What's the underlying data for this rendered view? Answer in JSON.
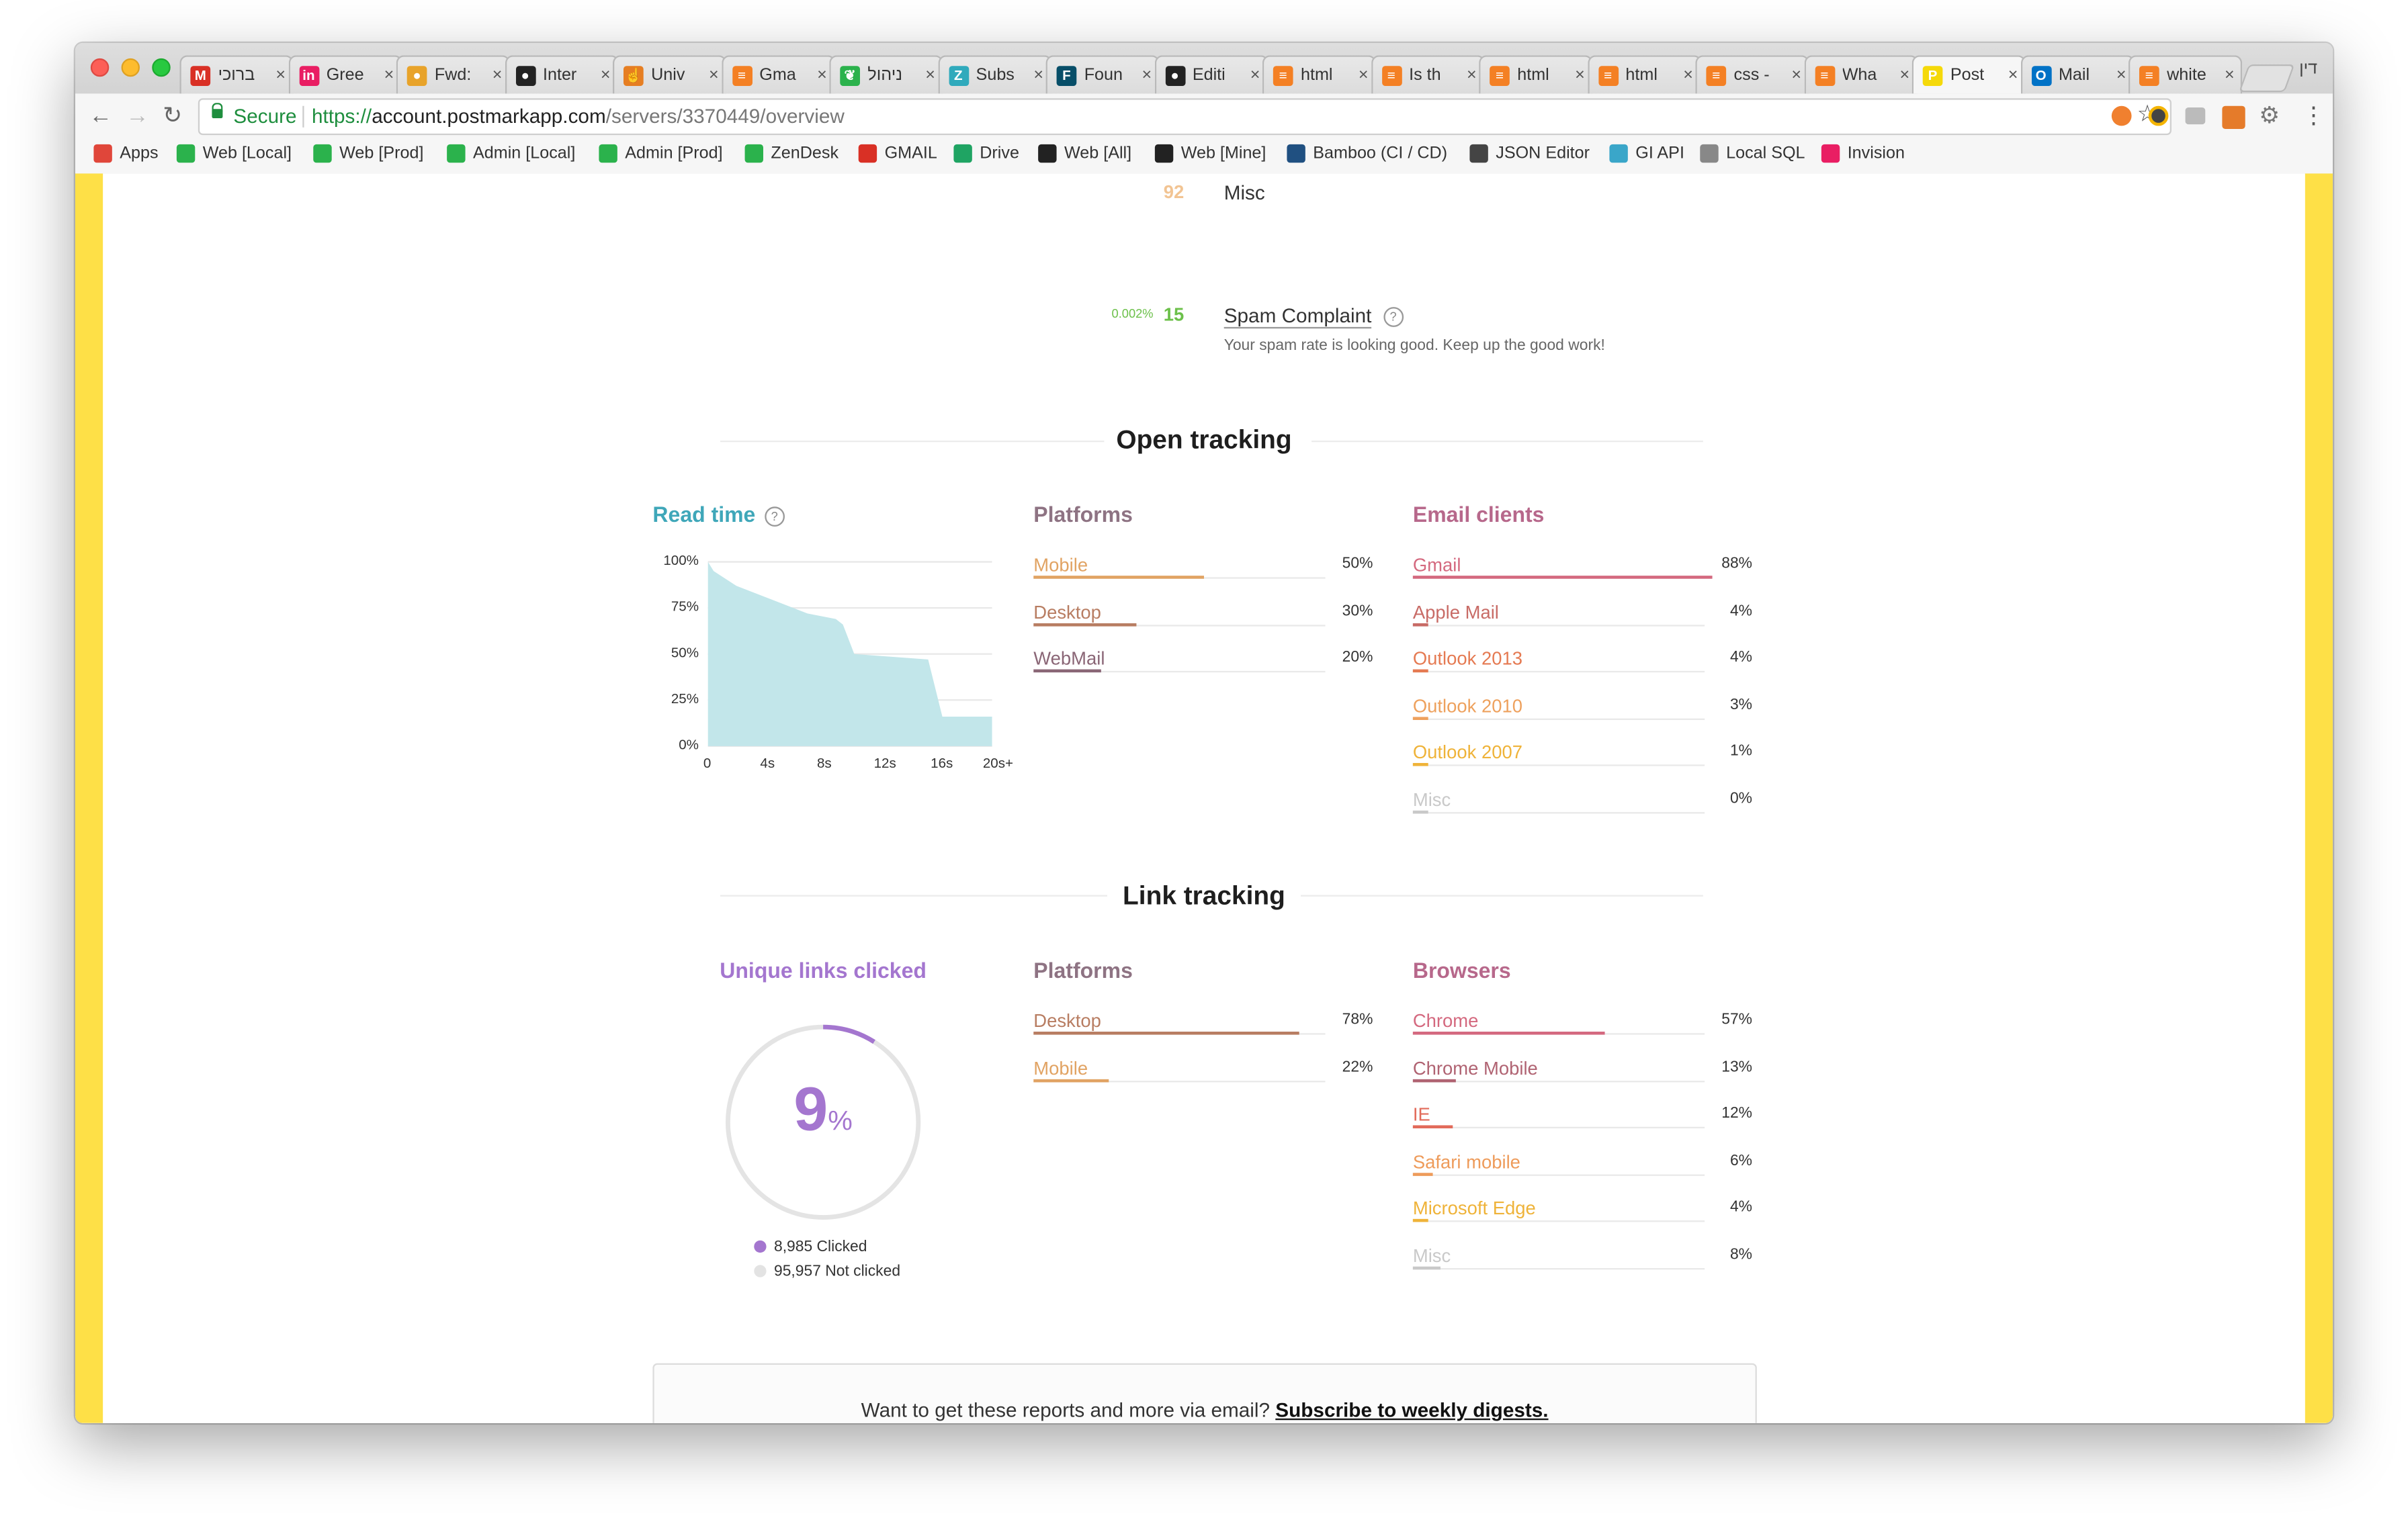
{
  "browser": {
    "tabs": [
      {
        "label": "ברוכי",
        "icon": "gmail-icon",
        "color": "#d93025",
        "glyph": "M"
      },
      {
        "label": "Gree",
        "icon": "invision-icon",
        "color": "#e91e63",
        "glyph": "in"
      },
      {
        "label": "Fwd:",
        "icon": "chrome-webstore-icon",
        "color": "#e8a32a",
        "glyph": "●"
      },
      {
        "label": "Inter",
        "icon": "github-icon",
        "color": "#222222",
        "glyph": "●"
      },
      {
        "label": "Univ",
        "icon": "hand-icon",
        "color": "#e67e22",
        "glyph": "☝"
      },
      {
        "label": "Gma",
        "icon": "stackoverflow-icon",
        "color": "#f48024",
        "glyph": "≡"
      },
      {
        "label": "ניהול",
        "icon": "leaf-icon",
        "color": "#2bb24c",
        "glyph": "❦"
      },
      {
        "label": "Subs",
        "icon": "zendesk-icon",
        "color": "#30aabc",
        "glyph": "Z"
      },
      {
        "label": "Foun",
        "icon": "foundation-icon",
        "color": "#074e68",
        "glyph": "F"
      },
      {
        "label": "Editi",
        "icon": "github-icon",
        "color": "#222222",
        "glyph": "●"
      },
      {
        "label": "html",
        "icon": "stackoverflow-icon",
        "color": "#f48024",
        "glyph": "≡"
      },
      {
        "label": "Is th",
        "icon": "stackoverflow-icon",
        "color": "#f48024",
        "glyph": "≡"
      },
      {
        "label": "html",
        "icon": "stackoverflow-icon",
        "color": "#f48024",
        "glyph": "≡"
      },
      {
        "label": "html",
        "icon": "stackoverflow-icon",
        "color": "#f48024",
        "glyph": "≡"
      },
      {
        "label": "css -",
        "icon": "stackoverflow-icon",
        "color": "#f48024",
        "glyph": "≡"
      },
      {
        "label": "Wha",
        "icon": "stackoverflow-icon",
        "color": "#f48024",
        "glyph": "≡"
      },
      {
        "label": "Post",
        "icon": "postmark-icon",
        "color": "#f5d90a",
        "glyph": "P",
        "active": true
      },
      {
        "label": "Mail",
        "icon": "outlook-icon",
        "color": "#0072c6",
        "glyph": "O"
      },
      {
        "label": "white",
        "icon": "stackoverflow-icon",
        "color": "#f48024",
        "glyph": "≡"
      }
    ],
    "tab_close": "×",
    "profile_label": "דין",
    "url_secure": "Secure",
    "url_scheme": "https://",
    "url_host": "account.postmarkapp.com",
    "url_path": "/servers/3370449/overview",
    "bookmarks": [
      {
        "label": "Apps",
        "icon": "apps-grid-icon",
        "color": "#e0463a"
      },
      {
        "label": "Web [Local]",
        "icon": "leaf-icon",
        "color": "#2bb24c"
      },
      {
        "label": "Web [Prod]",
        "icon": "leaf-icon",
        "color": "#2bb24c"
      },
      {
        "label": "Admin [Local]",
        "icon": "leaf-icon",
        "color": "#2bb24c"
      },
      {
        "label": "Admin [Prod]",
        "icon": "leaf-icon",
        "color": "#2bb24c"
      },
      {
        "label": "ZenDesk",
        "icon": "zendesk-icon",
        "color": "#2bb24c"
      },
      {
        "label": "GMAIL",
        "icon": "gmail-icon",
        "color": "#d93025"
      },
      {
        "label": "Drive",
        "icon": "drive-icon",
        "color": "#1fa463"
      },
      {
        "label": "Web [All]",
        "icon": "github-icon",
        "color": "#222222"
      },
      {
        "label": "Web [Mine]",
        "icon": "github-icon",
        "color": "#222222"
      },
      {
        "label": "Bamboo (CI / CD)",
        "icon": "bamboo-icon",
        "color": "#205081"
      },
      {
        "label": "JSON Editor",
        "icon": "json-icon",
        "color": "#444444"
      },
      {
        "label": "GI API",
        "icon": "api-icon",
        "color": "#3aa6c9"
      },
      {
        "label": "Local SQL",
        "icon": "sql-icon",
        "color": "#888888"
      },
      {
        "label": "Invision",
        "icon": "invision-icon",
        "color": "#e91e63"
      }
    ]
  },
  "page": {
    "misc_count": "92",
    "misc_label": "Misc",
    "spam_rate": "0.002%",
    "spam_count": "15",
    "spam_label": "Spam Complaint",
    "spam_note": "Your spam rate is looking good. Keep up the good work!",
    "help_glyph": "?",
    "open_tracking": {
      "title": "Open tracking",
      "read_time_label": "Read time",
      "read_time_chart": {
        "y_ticks": [
          "100%",
          "75%",
          "50%",
          "25%",
          "0%"
        ],
        "x_ticks": [
          "0",
          "4s",
          "8s",
          "12s",
          "16s",
          "20s+"
        ]
      },
      "platforms_title": "Platforms",
      "platforms": [
        {
          "label": "Mobile",
          "pct": "50%",
          "value": 0.5,
          "color": "#e1a363"
        },
        {
          "label": "Desktop",
          "pct": "30%",
          "value": 0.3,
          "color": "#b87d62"
        },
        {
          "label": "WebMail",
          "pct": "20%",
          "value": 0.2,
          "color": "#8a6676"
        }
      ],
      "clients_title": "Email clients",
      "clients": [
        {
          "label": "Gmail",
          "pct": "88%",
          "value": 0.88,
          "color": "#d4697f"
        },
        {
          "label": "Apple Mail",
          "pct": "4%",
          "value": 0.04,
          "color": "#c86b66"
        },
        {
          "label": "Outlook 2013",
          "pct": "4%",
          "value": 0.04,
          "color": "#e57a52"
        },
        {
          "label": "Outlook 2010",
          "pct": "3%",
          "value": 0.03,
          "color": "#eea15d"
        },
        {
          "label": "Outlook 2007",
          "pct": "1%",
          "value": 0.01,
          "color": "#efb339"
        },
        {
          "label": "Misc",
          "pct": "0%",
          "value": 0.0,
          "color": "#c9c9c9"
        }
      ]
    },
    "link_tracking": {
      "title": "Link tracking",
      "unique_title": "Unique links clicked",
      "unique_pct_value": 0.09,
      "unique_pct_number": "9",
      "unique_pct_symbol": "%",
      "clicked": "8,985 Clicked",
      "not_clicked": "95,957 Not clicked",
      "platforms_title": "Platforms",
      "platforms": [
        {
          "label": "Desktop",
          "pct": "78%",
          "value": 0.78,
          "color": "#b87d62"
        },
        {
          "label": "Mobile",
          "pct": "22%",
          "value": 0.22,
          "color": "#e1a363"
        }
      ],
      "browsers_title": "Browsers",
      "browsers": [
        {
          "label": "Chrome",
          "pct": "57%",
          "value": 0.57,
          "color": "#d4697f"
        },
        {
          "label": "Chrome Mobile",
          "pct": "13%",
          "value": 0.13,
          "color": "#b06372"
        },
        {
          "label": "IE",
          "pct": "12%",
          "value": 0.12,
          "color": "#e26b5a"
        },
        {
          "label": "Safari mobile",
          "pct": "6%",
          "value": 0.06,
          "color": "#ee9b5a"
        },
        {
          "label": "Microsoft Edge",
          "pct": "4%",
          "value": 0.04,
          "color": "#efb339"
        },
        {
          "label": "Misc",
          "pct": "8%",
          "value": 0.08,
          "color": "#c9c9c9"
        }
      ]
    },
    "digest_text": "Want to get these reports and more via email?",
    "digest_link": "Subscribe to weekly digests."
  },
  "colors": {
    "read_time_accent": "#3fa7b9",
    "read_time_fill": "#c2e6ea",
    "clients_accent": "#b7688b",
    "browsers_accent": "#b7688b",
    "platforms_accent": "#8e7383",
    "unique_accent": "#a476cf",
    "spam_green": "#6cc04a",
    "misc_orange": "#f2c493",
    "sidebar_yellow": "#fee047"
  }
}
